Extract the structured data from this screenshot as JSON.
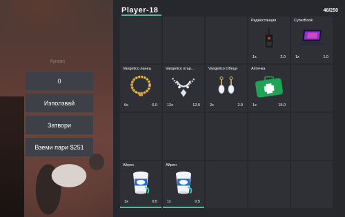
{
  "background": {
    "caption": "Хунган"
  },
  "menu": {
    "items": [
      {
        "label": "0"
      },
      {
        "label": "Използвай"
      },
      {
        "label": "Затвори"
      },
      {
        "label": "Вземи пари $251"
      }
    ]
  },
  "inventory": {
    "title": "Player-18",
    "weight": "48/250",
    "accent_color": "#3ec4a0",
    "slots": [
      {
        "index": 3,
        "label": "Радиостанция",
        "count": "1x",
        "weight": "2.0",
        "icon": "radio-icon"
      },
      {
        "index": 4,
        "label": "CyberBook",
        "count": "1x",
        "weight": "1.0",
        "icon": "laptop-icon"
      },
      {
        "index": 5,
        "label": "Vangelico ланец",
        "count": "6x",
        "weight": "6.0",
        "icon": "gold-chain-icon"
      },
      {
        "index": 6,
        "label": "Vangelico огър...",
        "count": "12x",
        "weight": "12.0",
        "icon": "diamond-necklace-icon"
      },
      {
        "index": 7,
        "label": "Vangelico Обеци",
        "count": "2x",
        "weight": "2.0",
        "icon": "earrings-icon"
      },
      {
        "index": 8,
        "label": "Аптечка",
        "count": "1x",
        "weight": "15.0",
        "icon": "medkit-icon"
      },
      {
        "index": 15,
        "label": "Айрян",
        "count": "1x",
        "weight": "0.5",
        "icon": "ayran-cup-icon",
        "durability": 1.0
      },
      {
        "index": 16,
        "label": "Айрян",
        "count": "1x",
        "weight": "0.5",
        "icon": "ayran-cup-icon",
        "durability": 1.0
      }
    ]
  }
}
